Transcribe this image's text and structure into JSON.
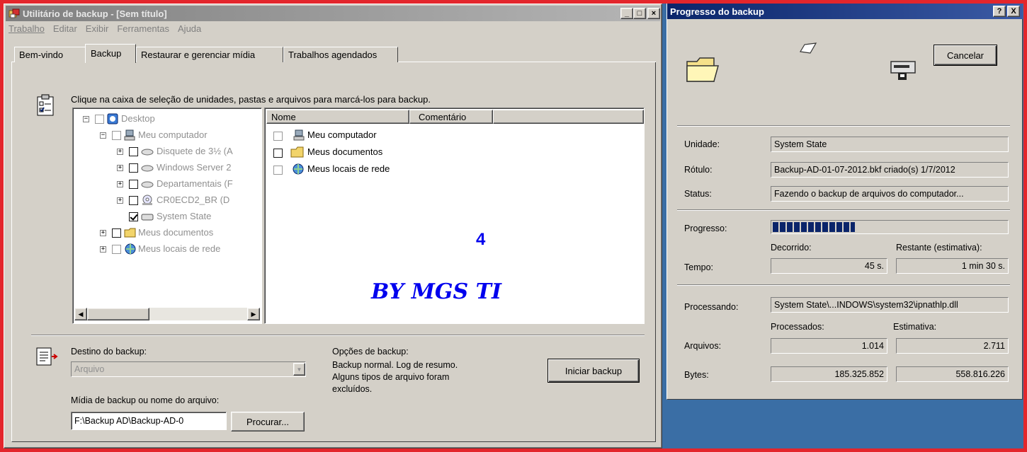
{
  "backup_window": {
    "title": "Utilitário de backup - [Sem título]",
    "menu": [
      "Trabalho",
      "Editar",
      "Exibir",
      "Ferramentas",
      "Ajuda"
    ],
    "tabs": [
      "Bem-vindo",
      "Backup",
      "Restaurar e gerenciar mídia",
      "Trabalhos agendados"
    ],
    "active_tab": "Backup",
    "instruction": "Clique na caixa de seleção de unidades, pastas e arquivos para marcá-los para backup.",
    "tree": [
      {
        "label": "Desktop"
      },
      {
        "label": "Meu computador"
      },
      {
        "label": "Disquete de 3½ (A"
      },
      {
        "label": "Windows Server 2"
      },
      {
        "label": "Departamentais (F"
      },
      {
        "label": "CR0ECD2_BR (D"
      },
      {
        "label": "System State",
        "checked": true
      },
      {
        "label": "Meus documentos"
      },
      {
        "label": "Meus locais de rede"
      }
    ],
    "list_columns": [
      "Nome",
      "Comentário"
    ],
    "list_items": [
      "Meu computador",
      "Meus documentos",
      "Meus locais de rede"
    ],
    "watermark_number": "4",
    "watermark_text": "BY MGS TI",
    "destination_label": "Destino do backup:",
    "destination_value": "Arquivo",
    "media_label": "Mídia de backup ou nome do arquivo:",
    "media_value": "F:\\Backup AD\\Backup-AD-0",
    "browse_button": "Procurar...",
    "options_label": "Opções de backup:",
    "options_text_1": "Backup normal.  Log de resumo.",
    "options_text_2": "Alguns tipos de arquivo foram",
    "options_text_3": "excluídos.",
    "start_button": "Iniciar backup"
  },
  "progress_window": {
    "title": "Progresso do backup",
    "help_btn": "?",
    "close_btn": "X",
    "cancel_button": "Cancelar",
    "drive_label": "Unidade:",
    "drive_value": "System State",
    "label_label": "Rótulo:",
    "label_value": "Backup-AD-01-07-2012.bkf criado(s) 1/7/2012",
    "status_label": "Status:",
    "status_value": "Fazendo o backup de arquivos do computador...",
    "progress_label": "Progresso:",
    "progress_fraction": 0.35,
    "elapsed_header": "Decorrido:",
    "remaining_header": "Restante (estimativa):",
    "time_label": "Tempo:",
    "elapsed_value": "45 s.",
    "remaining_value": "1 min 30 s.",
    "processing_label": "Processando:",
    "processing_value": "System State\\...INDOWS\\system32\\ipnathlp.dll",
    "processed_header": "Processados:",
    "estimate_header": "Estimativa:",
    "files_label": "Arquivos:",
    "files_processed": "1.014",
    "files_estimate": "2.711",
    "bytes_label": "Bytes:",
    "bytes_processed": "185.325.852",
    "bytes_estimate": "558.816.226"
  },
  "colors": {
    "frame": "#e3262c",
    "titlebar_inactive": "#808080",
    "titlebar_active": "#0a246a",
    "desktop": "#3a6ea5",
    "progress_block": "#0a246a",
    "watermark": "#0000ee"
  }
}
